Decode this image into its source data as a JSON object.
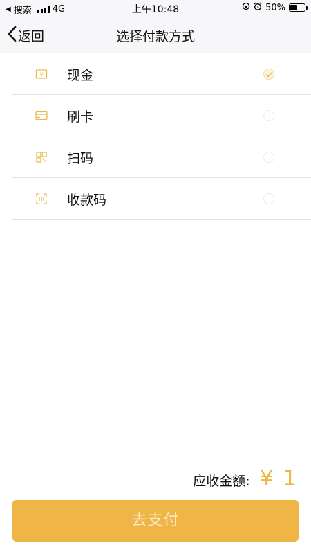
{
  "status_bar": {
    "back_app": "搜索",
    "network": "4G",
    "time": "上午10:48",
    "battery": "50%",
    "battery_level": 0.5
  },
  "nav": {
    "back_label": "返回",
    "title": "选择付款方式"
  },
  "payment_methods": [
    {
      "label": "现金",
      "icon": "cash-icon",
      "selected": true
    },
    {
      "label": "刷卡",
      "icon": "card-icon",
      "selected": false
    },
    {
      "label": "扫码",
      "icon": "qr-scan-icon",
      "selected": false
    },
    {
      "label": "收款码",
      "icon": "payment-code-icon",
      "selected": false
    }
  ],
  "amount": {
    "label": "应收金额:",
    "value": "¥ 1"
  },
  "pay_button": {
    "label": "去支付"
  },
  "colors": {
    "accent": "#efb546",
    "amount": "#eeb544",
    "button_text": "#fbe8c4",
    "icon": "#e9b94d"
  }
}
